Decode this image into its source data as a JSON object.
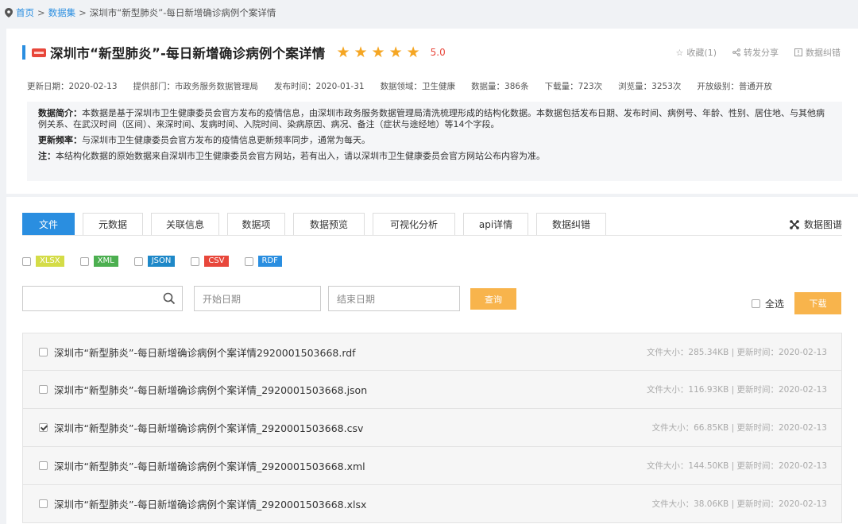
{
  "breadcrumb": {
    "home": "首页",
    "sep1": ">",
    "datasets": "数据集",
    "sep2": ">",
    "current": "深圳市“新型肺炎”-每日新增确诊病例个案详情"
  },
  "header": {
    "title": "深圳市“新型肺炎”-每日新增确诊病例个案详情",
    "rating_stars": 5,
    "rating": "5.0",
    "actions": {
      "favorite": "收藏(1)",
      "share": "转发分享",
      "report": "数据纠错"
    }
  },
  "meta": {
    "update_date": "更新日期：2020-02-13",
    "department": "提供部门：市政务服务数据管理局",
    "publish_time": "发布时间：2020-01-31",
    "domain": "数据领域：卫生健康",
    "data_count": "数据量：386条",
    "downloads": "下载量：723次",
    "views": "浏览量：3253次",
    "open_level": "开放级别：普通开放"
  },
  "description": {
    "intro_label": "数据简介：",
    "intro_text": "本数据是基于深圳市卫生健康委员会官方发布的疫情信息，由深圳市政务服务数据管理局清洗梳理形成的结构化数据。本数据包括发布日期、发布时间、病例号、年龄、性别、居住地、与其他病例关系、在武汉时间（区间）、来深时间、发病时间、入院时间、染病原因、病况、备注（症状与途经地）等14个字段。",
    "freq_label": "更新频率：",
    "freq_text": "与深圳市卫生健康委员会官方发布的疫情信息更新频率同步，通常为每天。",
    "note_label": "注：",
    "note_text": "本结构化数据的原始数据来自深圳市卫生健康委员会官方网站，若有出入，请以深圳市卫生健康委员会官方网站公布内容为准。"
  },
  "tabs": [
    {
      "label": "文件",
      "active": true
    },
    {
      "label": "元数据",
      "active": false
    },
    {
      "label": "关联信息",
      "active": false
    },
    {
      "label": "数据项",
      "active": false
    },
    {
      "label": "数据预览",
      "active": false
    },
    {
      "label": "可视化分析",
      "active": false
    },
    {
      "label": "api详情",
      "active": false
    },
    {
      "label": "数据纠错",
      "active": false
    }
  ],
  "graph_link": "数据图谱",
  "formats": [
    {
      "label": "XLSX",
      "color": "#d4dc47",
      "text_color": "#ffffff"
    },
    {
      "label": "XML",
      "color": "#4caf50",
      "text_color": "#ffffff"
    },
    {
      "label": "JSON",
      "color": "#1e88c8",
      "text_color": "#ffffff"
    },
    {
      "label": "CSV",
      "color": "#e8473b",
      "text_color": "#ffffff"
    },
    {
      "label": "RDF",
      "color": "#2a8ee0",
      "text_color": "#ffffff"
    }
  ],
  "filter": {
    "search_placeholder": "",
    "start_placeholder": "开始日期",
    "end_placeholder": "结束日期",
    "query_label": "查询",
    "select_all_label": "全选",
    "download_label": "下载"
  },
  "files": [
    {
      "name": "深圳市“新型肺炎”-每日新增确诊病例个案详情2920001503668.rdf",
      "info": "文件大小：285.34KB | 更新时间：2020-02-13",
      "checked": false
    },
    {
      "name": "深圳市“新型肺炎”-每日新增确诊病例个案详情_2920001503668.json",
      "info": "文件大小：116.93KB | 更新时间：2020-02-13",
      "checked": false
    },
    {
      "name": "深圳市“新型肺炎”-每日新增确诊病例个案详情_2920001503668.csv",
      "info": "文件大小：66.85KB | 更新时间：2020-02-13",
      "checked": true
    },
    {
      "name": "深圳市“新型肺炎”-每日新增确诊病例个案详情_2920001503668.xml",
      "info": "文件大小：144.50KB | 更新时间：2020-02-13",
      "checked": false
    },
    {
      "name": "深圳市“新型肺炎”-每日新增确诊病例个案详情_2920001503668.xlsx",
      "info": "文件大小：38.06KB | 更新时间：2020-02-13",
      "checked": false
    }
  ]
}
